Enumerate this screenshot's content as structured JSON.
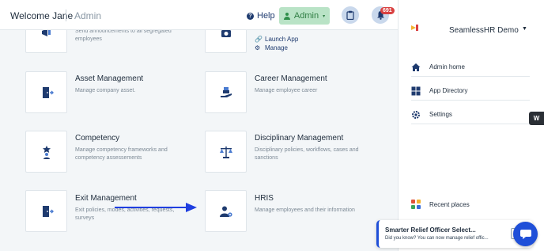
{
  "header": {
    "welcome": "Welcome Jane",
    "role": "Admin",
    "help_label": "Help",
    "admin_label": "Admin",
    "notification_count": "691"
  },
  "cards": {
    "announcements": {
      "title": "",
      "desc_line1": "Send announcements to all segregated",
      "desc_line2": "employees"
    },
    "asset": {
      "title": "Asset Management",
      "desc_line1": "Manage company asset."
    },
    "career": {
      "title": "Career Management",
      "desc_line1": "Manage employee career"
    },
    "competency": {
      "title": "Competency",
      "desc_line1": "Manage competency frameworks and",
      "desc_line2": "competency assessements"
    },
    "disciplinary": {
      "title": "Disciplinary Management",
      "desc_line1": "Disciplinary policies, workflows, cases and",
      "desc_line2": "sanctions"
    },
    "exit": {
      "title": "Exit Management",
      "desc_line1": "Exit policies, modes, activities, requests,",
      "desc_line2": "surveys"
    },
    "hris": {
      "title": "HRIS",
      "desc_line1": "Manage employees and their information"
    }
  },
  "launch_links": {
    "launch_app": "Launch App",
    "manage": "Manage"
  },
  "right_panel": {
    "company": "SeamlessHR Demo",
    "nav": {
      "admin_home": "Admin home",
      "app_directory": "App Directory",
      "settings": "Settings"
    },
    "recent": "Recent places"
  },
  "side_tab": "W",
  "toast": {
    "title": "Smarter Relief Officer Select...",
    "body": "Did you know? You can now manage relief offic..."
  },
  "colors": {
    "primary": "#1f3b6f",
    "accent_green": "#b9e3c6",
    "badge_red": "#d94141",
    "toast_blue": "#1f4fd8"
  }
}
